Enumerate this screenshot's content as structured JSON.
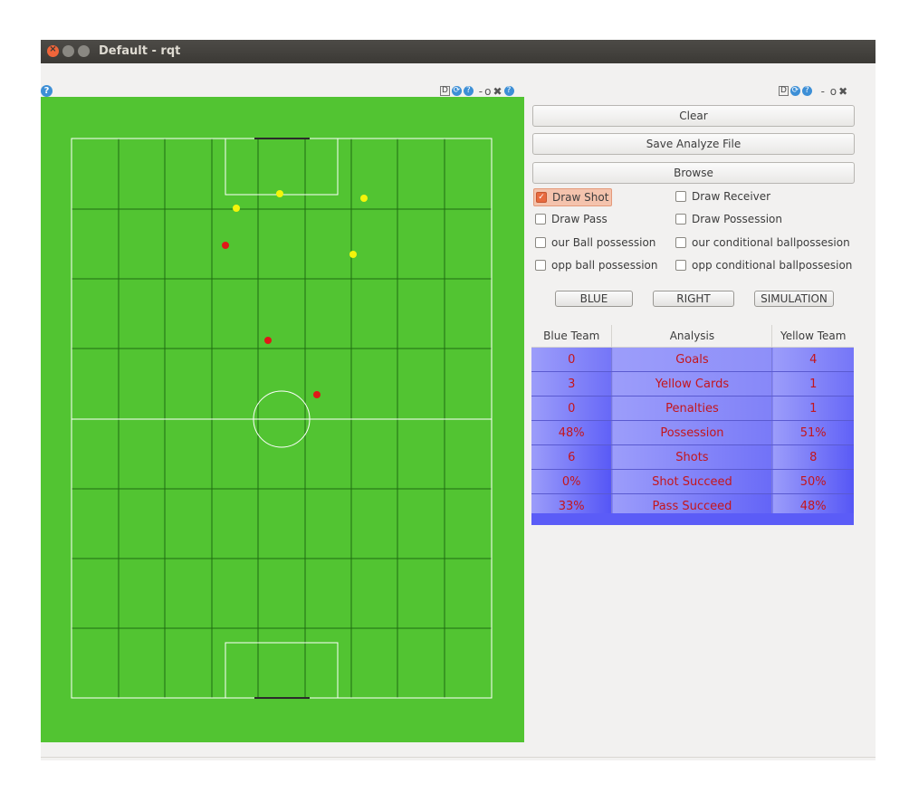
{
  "window": {
    "title": "Default - rqt",
    "buttons": [
      "close",
      "minimize",
      "maximize"
    ]
  },
  "dock_left": {
    "help_icon": "?",
    "controls": "D ⟳ ? - O ✖"
  },
  "dock_right": {
    "help_icon": "?",
    "controls": "D ⟳ ? - O ✖"
  },
  "field": {
    "grass_color": "#52c432",
    "line_color": "#ffffff",
    "grid_color": "#1f6b12",
    "yellow_robots": 4,
    "red_robots": 3
  },
  "buttons": {
    "clear": "Clear",
    "save": "Save Analyze File",
    "browse": "Browse"
  },
  "checkboxes": [
    {
      "label": "Draw Shot",
      "checked": true
    },
    {
      "label": "Draw Receiver",
      "checked": false
    },
    {
      "label": "Draw Pass",
      "checked": false
    },
    {
      "label": "Draw Possession",
      "checked": false
    },
    {
      "label": "our Ball possession",
      "checked": false
    },
    {
      "label": "our conditional ballpossesion",
      "checked": false
    },
    {
      "label": "opp ball possession",
      "checked": false
    },
    {
      "label": "opp conditional ballpossesion",
      "checked": false
    }
  ],
  "modes": {
    "team": "BLUE",
    "side": "RIGHT",
    "source": "SIMULATION"
  },
  "table": {
    "headers": [
      "Blue Team",
      "Analysis",
      "Yellow Team"
    ],
    "rows": [
      [
        "0",
        "Goals",
        "4"
      ],
      [
        "3",
        "Yellow Cards",
        "1"
      ],
      [
        "0",
        "Penalties",
        "1"
      ],
      [
        "48%",
        "Possession",
        "51%"
      ],
      [
        "6",
        "Shots",
        "8"
      ],
      [
        "0%",
        "Shot Succeed",
        "50%"
      ],
      [
        "33%",
        "Pass Succeed",
        "48%"
      ]
    ]
  },
  "colors": {
    "table_blue_light": "#9c9dfa",
    "table_blue_dark": "#5556f6",
    "table_text": "#c4151c",
    "checked_accent": "#e86a3f"
  }
}
